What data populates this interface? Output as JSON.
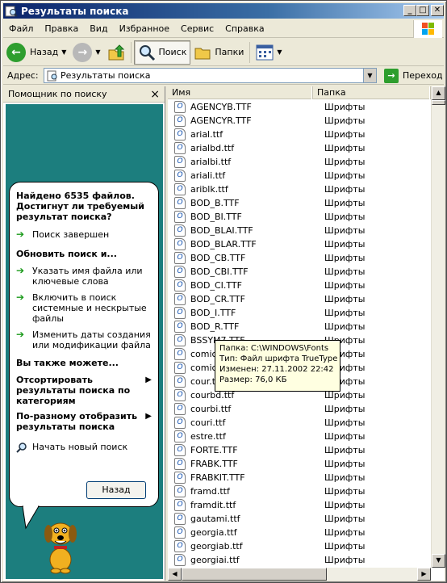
{
  "window": {
    "title": "Результаты поиска",
    "min_label": "_",
    "max_label": "□",
    "close_label": "✕"
  },
  "menu": [
    "Файл",
    "Правка",
    "Вид",
    "Избранное",
    "Сервис",
    "Справка"
  ],
  "toolbar": {
    "back": "Назад",
    "search": "Поиск",
    "folders": "Папки"
  },
  "address": {
    "label": "Адрес:",
    "value": "Результаты поиска",
    "go": "Переход"
  },
  "search_pane": {
    "header": "Помощник по поиску",
    "close": "×",
    "found": "Найдено 6535 файлов. Достигнут ли требуемый результат поиска?",
    "done": "Поиск завершен",
    "refine": "Обновить поиск и...",
    "opt1": "Указать имя файла или ключевые слова",
    "opt2": "Включить в поиск системные и нескрытые файлы",
    "opt3": "Изменить даты создания или модификации файла",
    "also": "Вы также можете...",
    "sort": "Отсортировать результаты поиска по категориям",
    "view": "По-разному отобразить результаты поиска",
    "new_search": "Начать новый поиск",
    "back_btn": "Назад"
  },
  "columns": {
    "name": "Имя",
    "folder": "Папка"
  },
  "files": [
    {
      "name": "AGENCYB.TTF",
      "folder": "Шрифты"
    },
    {
      "name": "AGENCYR.TTF",
      "folder": "Шрифты"
    },
    {
      "name": "arial.ttf",
      "folder": "Шрифты"
    },
    {
      "name": "arialbd.ttf",
      "folder": "Шрифты"
    },
    {
      "name": "arialbi.ttf",
      "folder": "Шрифты"
    },
    {
      "name": "ariali.ttf",
      "folder": "Шрифты"
    },
    {
      "name": "ariblk.ttf",
      "folder": "Шрифты"
    },
    {
      "name": "BOD_B.TTF",
      "folder": "Шрифты"
    },
    {
      "name": "BOD_BI.TTF",
      "folder": "Шрифты"
    },
    {
      "name": "BOD_BLAI.TTF",
      "folder": "Шрифты"
    },
    {
      "name": "BOD_BLAR.TTF",
      "folder": "Шрифты"
    },
    {
      "name": "BOD_CB.TTF",
      "folder": "Шрифты"
    },
    {
      "name": "BOD_CBI.TTF",
      "folder": "Шрифты"
    },
    {
      "name": "BOD_CI.TTF",
      "folder": "Шрифты"
    },
    {
      "name": "BOD_CR.TTF",
      "folder": "Шрифты"
    },
    {
      "name": "BOD_I.TTF",
      "folder": "Шрифты"
    },
    {
      "name": "BOD_R.TTF",
      "folder": "Шрифты"
    },
    {
      "name": "BSSYM7.TTF",
      "folder": "Шрифты"
    },
    {
      "name": "comic.ttf",
      "folder": "Шрифты"
    },
    {
      "name": "comicbd.ttf",
      "folder": "Шрифты"
    },
    {
      "name": "cour.ttf",
      "folder": "Шрифты"
    },
    {
      "name": "courbd.ttf",
      "folder": "Шрифты"
    },
    {
      "name": "courbi.ttf",
      "folder": "Шрифты"
    },
    {
      "name": "couri.ttf",
      "folder": "Шрифты"
    },
    {
      "name": "estre.ttf",
      "folder": "Шрифты"
    },
    {
      "name": "FORTE.TTF",
      "folder": "Шрифты"
    },
    {
      "name": "FRABK.TTF",
      "folder": "Шрифты"
    },
    {
      "name": "FRABKIT.TTF",
      "folder": "Шрифты"
    },
    {
      "name": "framd.ttf",
      "folder": "Шрифты"
    },
    {
      "name": "framdit.ttf",
      "folder": "Шрифты"
    },
    {
      "name": "gautami.ttf",
      "folder": "Шрифты"
    },
    {
      "name": "georgia.ttf",
      "folder": "Шрифты"
    },
    {
      "name": "georgiab.ttf",
      "folder": "Шрифты"
    },
    {
      "name": "georgiai.ttf",
      "folder": "Шрифты"
    }
  ],
  "tooltip": {
    "folder": "Папка: C:\\WINDOWS\\Fonts",
    "type": "Тип: Файл шрифта TrueType",
    "modified": "Изменен: 27.11.2002 22:42",
    "size": "Размер: 76,0 КБ"
  }
}
